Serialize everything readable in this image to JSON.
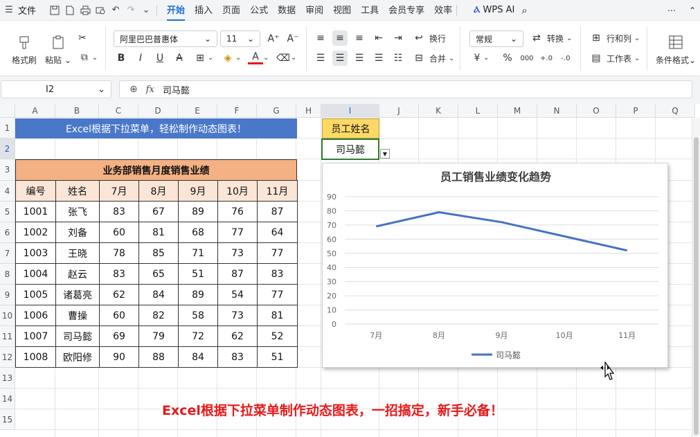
{
  "titlebar": {
    "file_label": "文件",
    "tabs": [
      "开始",
      "插入",
      "页面",
      "公式",
      "数据",
      "审阅",
      "视图",
      "工具",
      "会员专享",
      "效率"
    ],
    "active_tab": "开始",
    "ai_label": "WPS AI"
  },
  "ribbon": {
    "format_painter": "格式刷",
    "paste": "粘贴",
    "font_name": "阿里巴巴普惠体",
    "font_size": "11",
    "wrap": "换行",
    "merge": "合并",
    "number_format": "常规",
    "convert": "转换",
    "rows_cols": "行和列",
    "worksheet": "工作表",
    "cond_format": "条件格式",
    "bold": "B",
    "italic": "I",
    "underline": "U",
    "strike": "A",
    "font_color_glyph": "A",
    "currency": "¥",
    "percent": "%",
    "thousands": "000",
    "inc_decimal": "+.0",
    "dec_decimal": "-.0"
  },
  "formula_bar": {
    "name_box": "I2",
    "fx": "fx",
    "content": "司马懿"
  },
  "grid": {
    "columns": [
      "A",
      "B",
      "C",
      "D",
      "E",
      "F",
      "G",
      "H",
      "I",
      "J",
      "K",
      "L",
      "M",
      "N",
      "O",
      "P",
      "Q"
    ],
    "rows": [
      "1",
      "2",
      "3",
      "4",
      "5",
      "6",
      "7",
      "8",
      "9",
      "10",
      "11",
      "12",
      "13",
      "14",
      "15"
    ],
    "selected_col": "I",
    "selected_row": "2"
  },
  "sheet": {
    "banner": "Excel根据下拉菜单，轻松制作动态图表！",
    "table_title": "业务部销售月度销售业绩",
    "headers": [
      "编号",
      "姓名",
      "7月",
      "8月",
      "9月",
      "10月",
      "11月"
    ],
    "rows": [
      [
        "1001",
        "张飞",
        "83",
        "67",
        "89",
        "76",
        "87"
      ],
      [
        "1002",
        "刘备",
        "60",
        "81",
        "68",
        "77",
        "64"
      ],
      [
        "1003",
        "王晓",
        "78",
        "85",
        "71",
        "73",
        "77"
      ],
      [
        "1004",
        "赵云",
        "83",
        "65",
        "51",
        "87",
        "83"
      ],
      [
        "1005",
        "诸葛亮",
        "62",
        "84",
        "89",
        "54",
        "77"
      ],
      [
        "1006",
        "曹操",
        "60",
        "82",
        "58",
        "73",
        "81"
      ],
      [
        "1007",
        "司马懿",
        "69",
        "79",
        "72",
        "62",
        "52"
      ],
      [
        "1008",
        "欧阳修",
        "90",
        "88",
        "84",
        "83",
        "51"
      ]
    ],
    "name_label": "员工姓名",
    "name_value": "司马懿",
    "caption": "Excel根据下拉菜单制作动态图表，一招搞定，新手必备！"
  },
  "chart_data": {
    "type": "line",
    "title": "员工销售业绩变化趋势",
    "categories": [
      "7月",
      "8月",
      "9月",
      "10月",
      "11月"
    ],
    "series": [
      {
        "name": "司马懿",
        "values": [
          69,
          79,
          72,
          62,
          52
        ]
      }
    ],
    "yticks": [
      "0",
      "10",
      "20",
      "30",
      "40",
      "50",
      "60",
      "70",
      "80",
      "90"
    ],
    "ylim": [
      0,
      90
    ],
    "grid": true,
    "legend": "bottom",
    "color": "#4472c4"
  }
}
